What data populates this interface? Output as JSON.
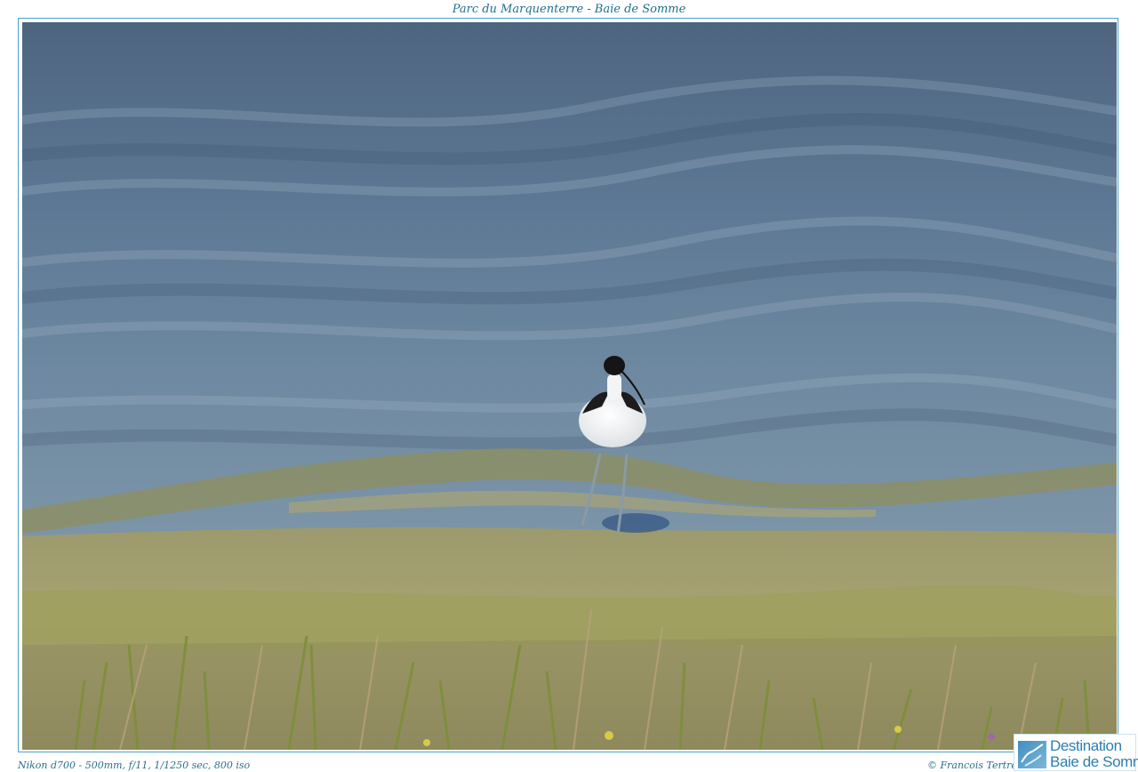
{
  "header": {
    "title": "Parc du Marquenterre - Baie de Somme"
  },
  "photo": {
    "subject": "pied-avocet-photo",
    "colors": {
      "water": "#56708c",
      "shore": "#a6a070",
      "grass": "#8a9a48"
    }
  },
  "footer": {
    "exif": "Nikon d700 - 500mm, f/11, 1/1250 sec, 800 iso",
    "credit": "© Francois Tertre"
  },
  "logo": {
    "line1": "Destination",
    "line2": "Baie de Somme",
    "icon": "bay-map-icon"
  }
}
